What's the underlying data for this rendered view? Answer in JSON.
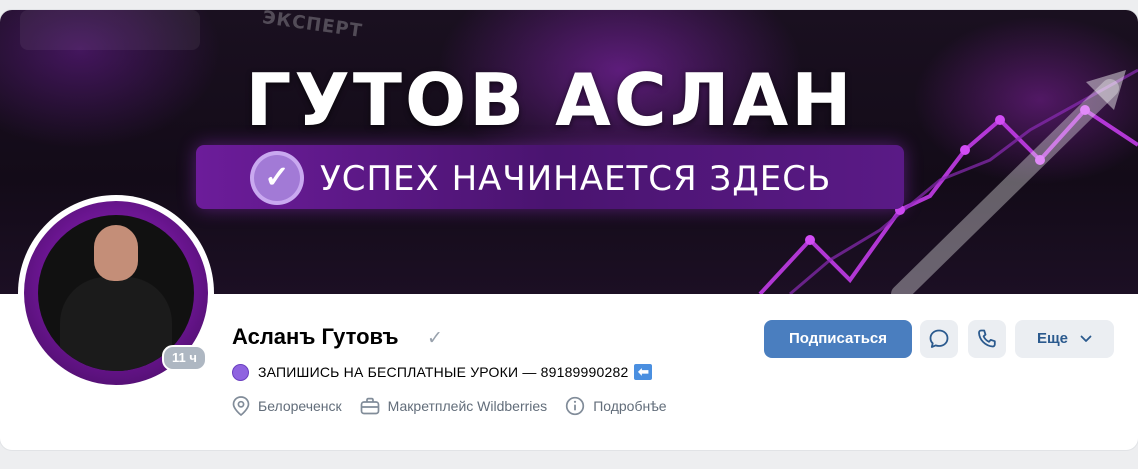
{
  "cover": {
    "title": "ГУТОВ АСЛАН",
    "subtitle": "УСПЕХ НАЧИНАЕТСЯ ЗДЕСЬ",
    "corner_word": "ЭКСПЕРТ",
    "check_glyph": "✓",
    "accent": "#b535e0"
  },
  "profile": {
    "name": "Асланъ Гутовъ",
    "verified_glyph": "✓",
    "last_seen": "11 ч",
    "status": "ЗАПИШИСЬ НА БЕСПЛАТНЫЕ УРОКИ — 89189990282",
    "status_arrow": "⬅",
    "city": "Белореченск",
    "work": "Макретплейс Wildberries",
    "details": "Подробнѣе"
  },
  "actions": {
    "subscribe": "Подписаться",
    "more": "Еще",
    "message_icon": "message-icon",
    "call_icon": "phone-icon"
  },
  "colors": {
    "primary_button": "#4a7ebf",
    "secondary_button": "#ebeef2",
    "muted_text": "#626d7a",
    "status_dot": "#8f63e0"
  }
}
